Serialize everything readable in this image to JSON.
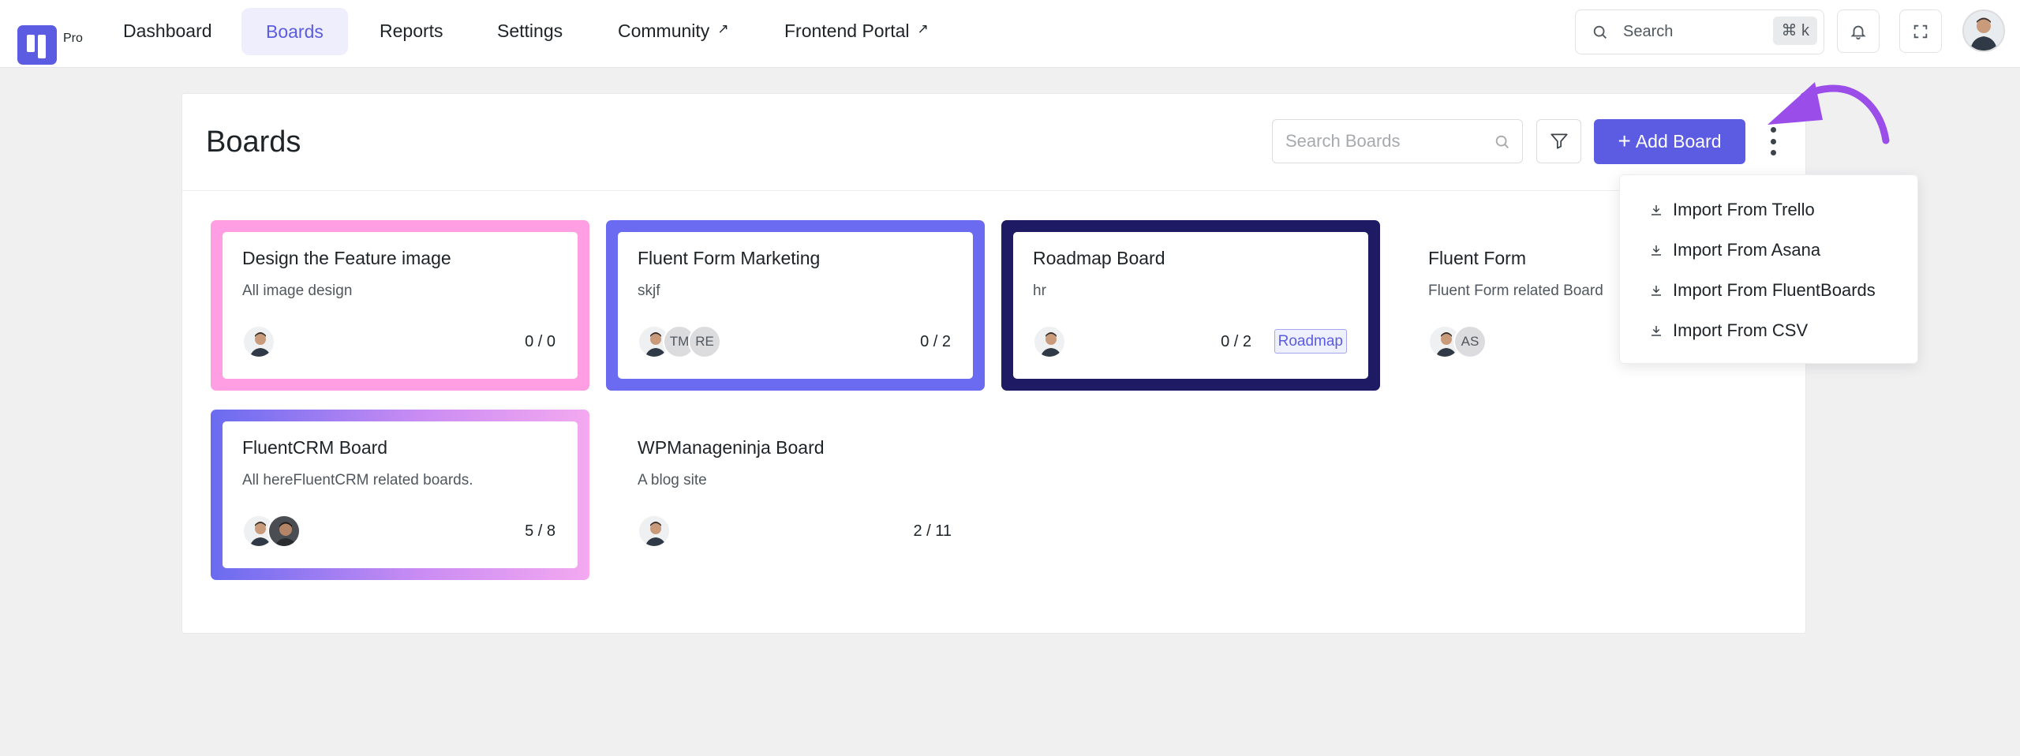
{
  "app": {
    "logo_label": "Pro"
  },
  "nav": {
    "items": [
      {
        "label": "Dashboard",
        "external": false,
        "active": false
      },
      {
        "label": "Boards",
        "external": false,
        "active": true
      },
      {
        "label": "Reports",
        "external": false,
        "active": false
      },
      {
        "label": "Settings",
        "external": false,
        "active": false
      },
      {
        "label": "Community",
        "external": true,
        "active": false
      },
      {
        "label": "Frontend Portal",
        "external": true,
        "active": false
      }
    ],
    "external_glyph": "↗"
  },
  "global_search": {
    "label": "Search",
    "shortcut": "⌘ k"
  },
  "header_icons": [
    "bell-icon",
    "fullscreen-icon",
    "user-avatar"
  ],
  "page": {
    "title": "Boards",
    "search_placeholder": "Search Boards",
    "add_button": {
      "icon": "+",
      "label": "Add Board"
    }
  },
  "boards": [
    {
      "title": "Design the Feature image",
      "description": "All image design",
      "members": [
        "avatar"
      ],
      "count": "0 / 0",
      "tag": null,
      "border": "solid",
      "color": "#ff9ee2"
    },
    {
      "title": "Fluent Form Marketing",
      "description": "skjf",
      "members": [
        "avatar",
        "TM",
        "RE"
      ],
      "count": "0 / 2",
      "tag": null,
      "border": "solid",
      "color": "#6a6bf0"
    },
    {
      "title": "Roadmap Board",
      "description": "hr",
      "members": [
        "avatar"
      ],
      "count": "0 / 2",
      "tag": "Roadmap",
      "border": "solid",
      "color": "#1e1a63"
    },
    {
      "title": "Fluent Form",
      "description": "Fluent Form related Board",
      "members": [
        "avatar",
        "AS"
      ],
      "count": "",
      "tag": null,
      "border": "none",
      "color": "#ffffff"
    },
    {
      "title": "FluentCRM Board",
      "description": "All hereFluentCRM related boards.",
      "members": [
        "avatar",
        "avatar-dark"
      ],
      "count": "5 / 8",
      "tag": null,
      "border": "gradient",
      "color": "#6a6bf0"
    },
    {
      "title": "WPManageninja Board",
      "description": "A blog site",
      "members": [
        "avatar"
      ],
      "count": "2 / 11",
      "tag": null,
      "border": "none",
      "color": "#ffffff"
    }
  ],
  "import_menu": {
    "items": [
      {
        "label": "Import From Trello",
        "icon": "download-icon"
      },
      {
        "label": "Import From Asana",
        "icon": "download-icon"
      },
      {
        "label": "Import From FluentBoards",
        "icon": "download-icon"
      },
      {
        "label": "Import From CSV",
        "icon": "download-icon"
      }
    ]
  },
  "colors": {
    "accent": "#5b5ce2",
    "annotation_arrow": "#9b4dea"
  }
}
